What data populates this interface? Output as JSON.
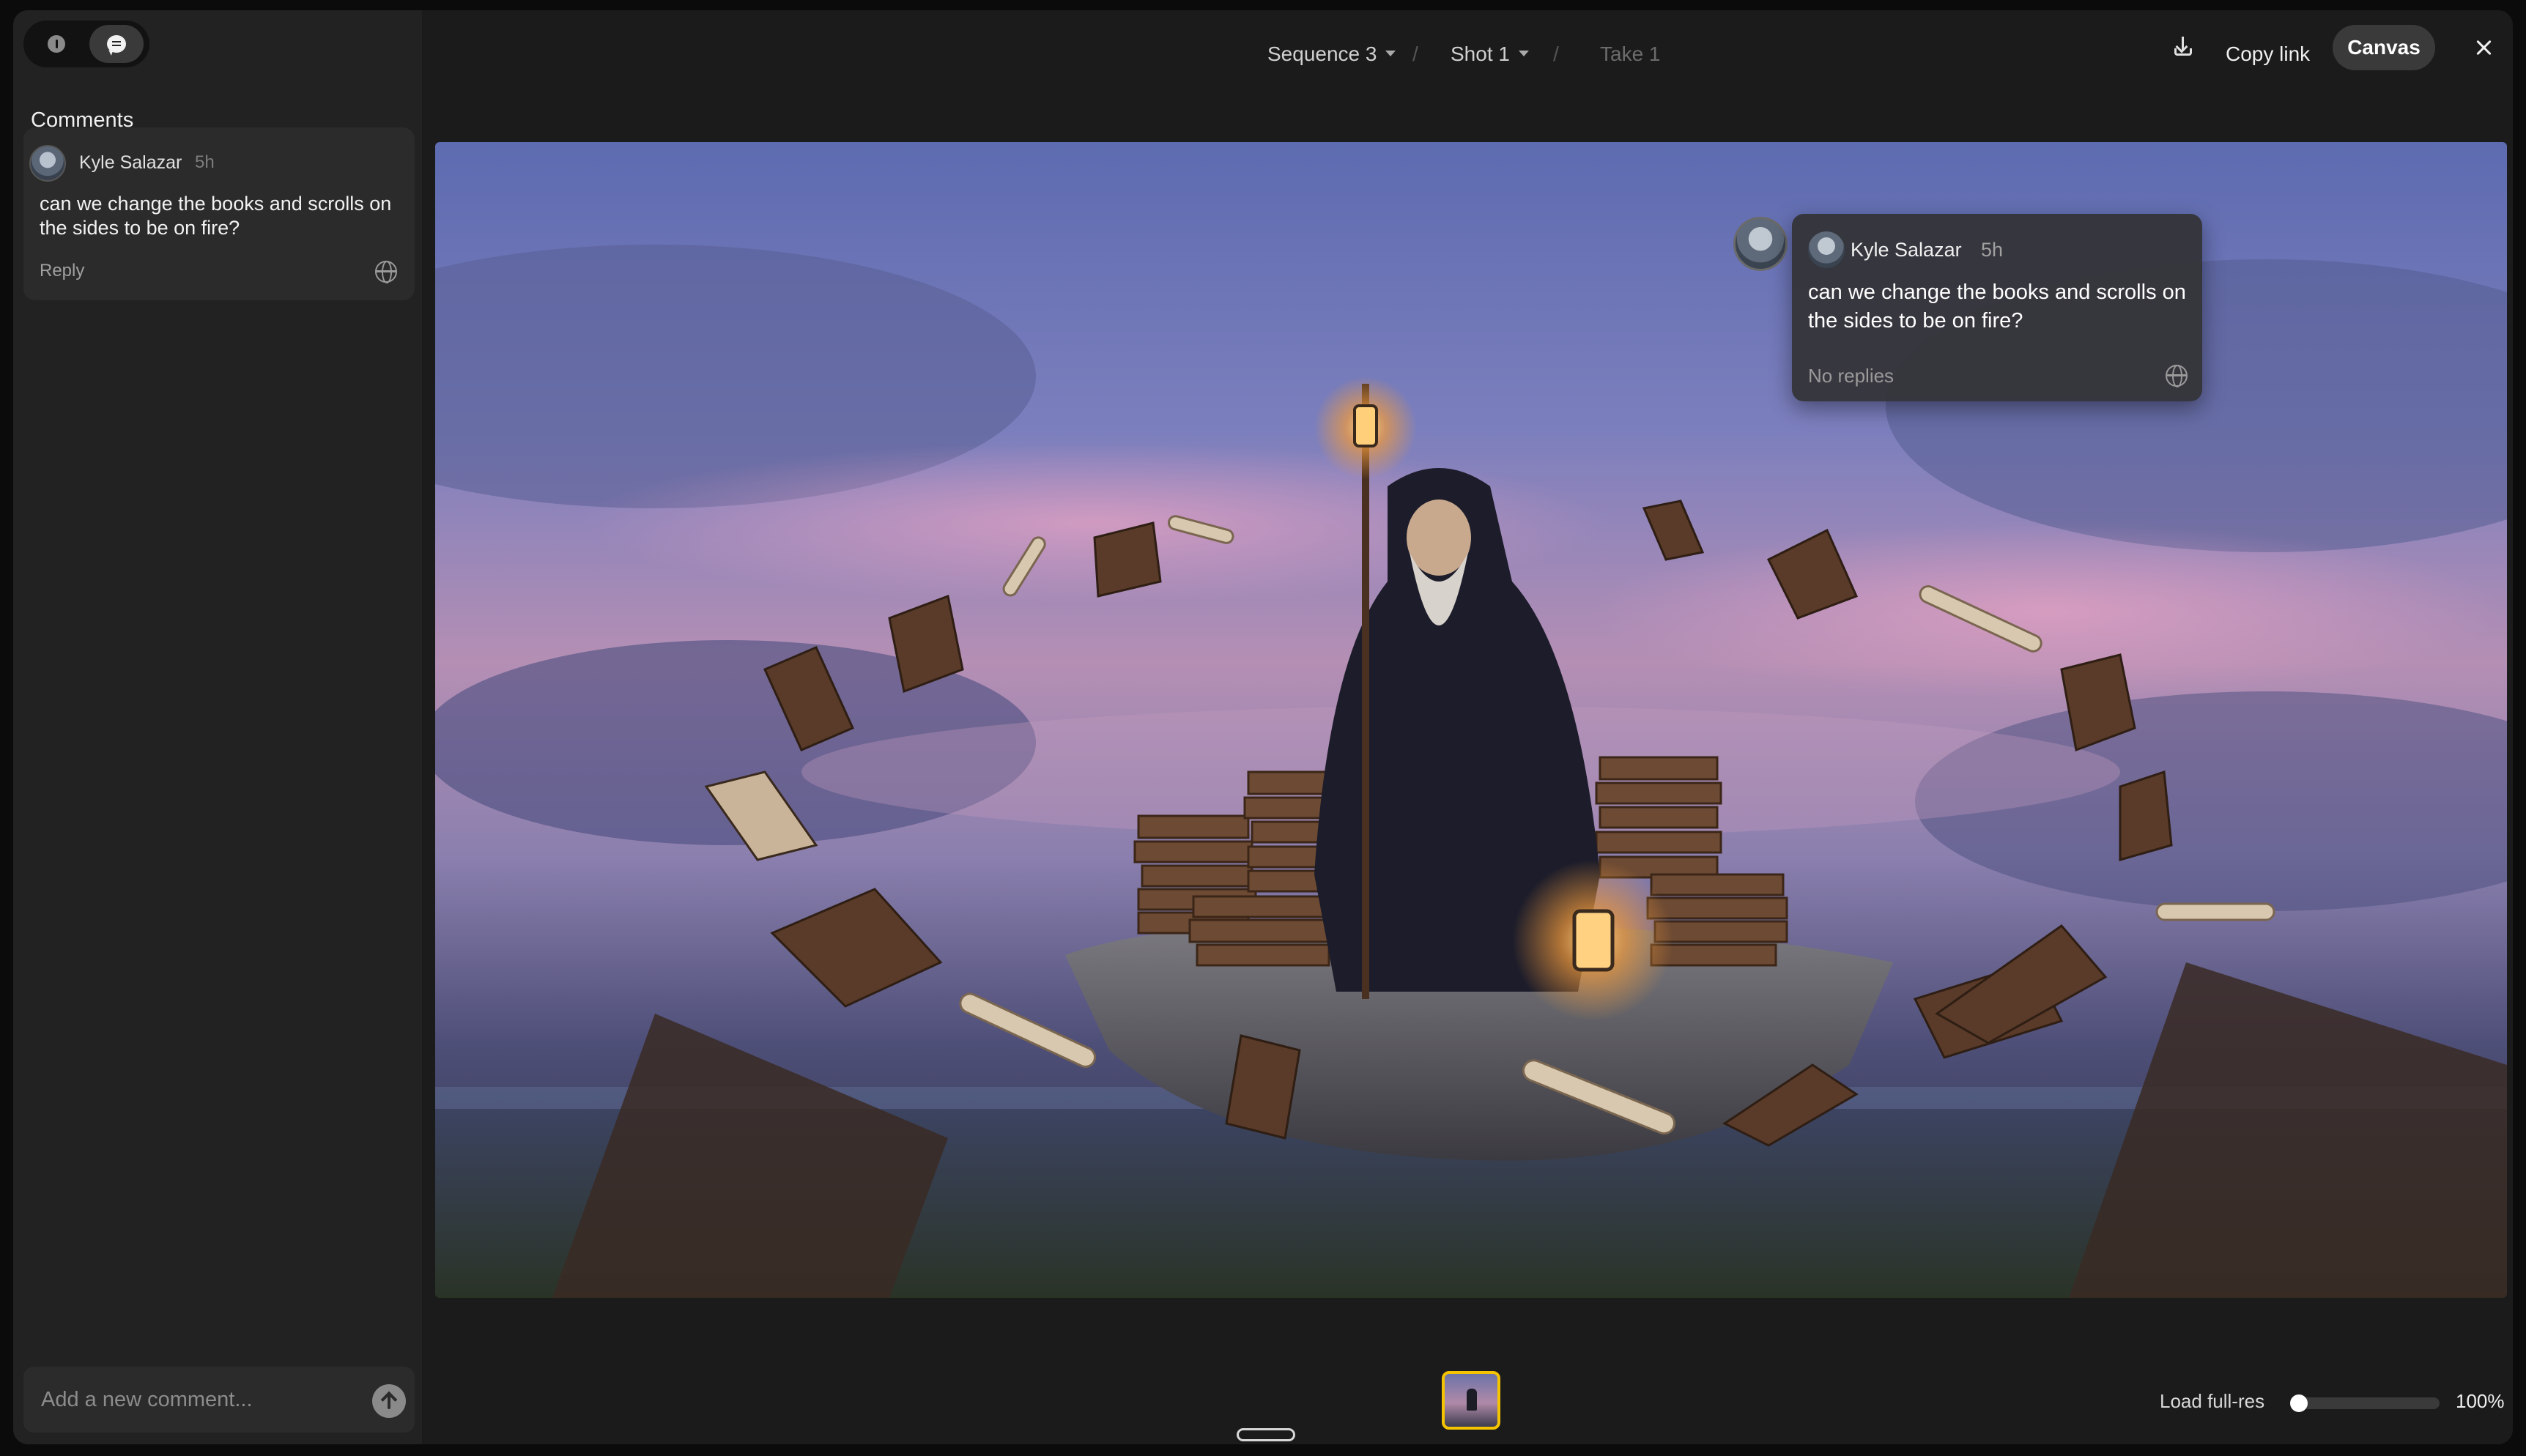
{
  "topbar": {
    "sequence": "Sequence 3",
    "shot": "Shot 1",
    "take": "Take 1",
    "copy_link": "Copy link",
    "canvas": "Canvas"
  },
  "sidebar": {
    "tabs": [
      {
        "icon": "info-icon",
        "active": false
      },
      {
        "icon": "comments-icon",
        "active": true
      }
    ],
    "title": "Comments",
    "comments": [
      {
        "author": "Kyle Salazar",
        "time": "5h",
        "text": "can we change the books and scrolls on the sides to be on fire?",
        "reply_label": "Reply"
      }
    ],
    "composer_placeholder": "Add a new comment..."
  },
  "canvas_comment": {
    "author": "Kyle Salazar",
    "time": "5h",
    "text": "can we change the books and scrolls on the sides to be on fire?",
    "replies": "No replies"
  },
  "footer": {
    "load_label": "Load full-res",
    "zoom": "100%",
    "load_progress": 0
  },
  "colors": {
    "background": "#1b1b1b",
    "sidebar": "#222222",
    "accent_thumb_border": "#f5c400"
  }
}
